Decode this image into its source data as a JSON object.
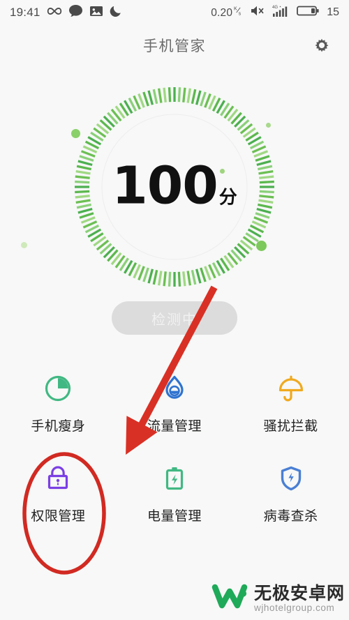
{
  "status_bar": {
    "time": "19:41",
    "left_icons": [
      "infinity-icon",
      "chat-bubble-icon",
      "image-icon",
      "moon-icon"
    ],
    "data_rate": "0.20",
    "data_rate_unit_top": "K",
    "data_rate_unit_bottom": "s",
    "volume_icon": "speaker-mute-icon",
    "network_label": "4G",
    "signal_icon": "signal-bars-icon",
    "battery_icon": "battery-icon",
    "battery_level": "15"
  },
  "app_bar": {
    "title": "手机管家",
    "settings_icon": "gear-icon"
  },
  "score": {
    "value": "100",
    "unit": "分",
    "ring_color_dark": "#4caf50",
    "ring_color_light": "#8bd07a",
    "ring_ticks": 120,
    "ring_progress_percent": 100
  },
  "scan_button": {
    "label": "检测中",
    "background": "#dcdcdc",
    "text_color": "#f1f1f1"
  },
  "features": [
    {
      "label": "手机瘦身",
      "icon": "pie-chart-icon",
      "color": "#41b883"
    },
    {
      "label": "流量管理",
      "icon": "water-drop-icon",
      "color": "#2f73d0"
    },
    {
      "label": "骚扰拦截",
      "icon": "umbrella-icon",
      "color": "#f0a91e"
    },
    {
      "label": "权限管理",
      "icon": "lock-icon",
      "color": "#7b3fe4"
    },
    {
      "label": "电量管理",
      "icon": "battery-bolt-icon",
      "color": "#41b883"
    },
    {
      "label": "病毒查杀",
      "icon": "shield-bolt-icon",
      "color": "#4a7fd4"
    }
  ],
  "annotations": {
    "arrow_color": "#d93025",
    "ellipse_color": "#d12a22",
    "arrow_target": "权限管理",
    "ellipse_target": "权限管理"
  },
  "watermark": {
    "logo_icon": "w-logo-icon",
    "name_cn": "无极安卓网",
    "name_en": "wjhotelgroup.com",
    "logo_color": "#1faa59"
  }
}
